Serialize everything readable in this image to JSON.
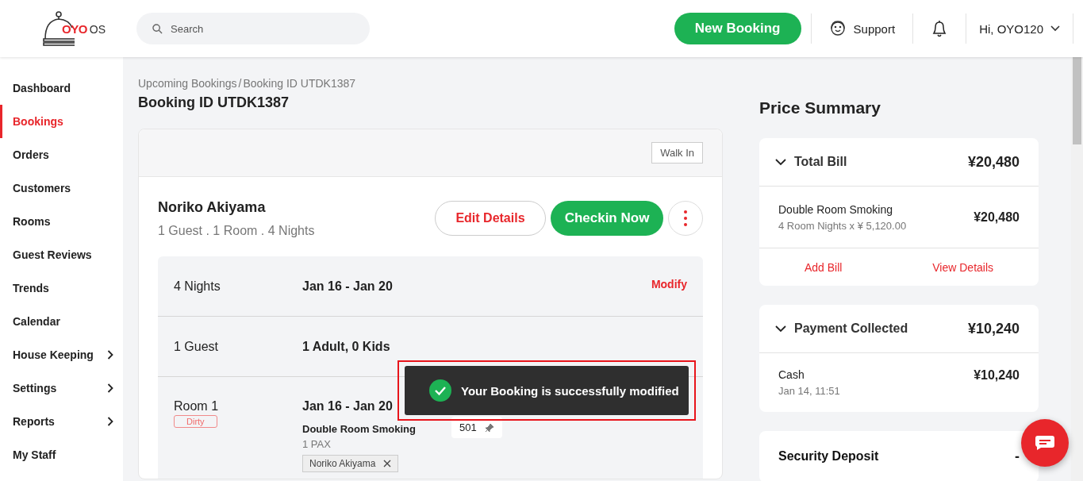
{
  "header": {
    "logo_brand": "OYO",
    "logo_suffix": "OS",
    "search": {
      "placeholder": "Search"
    },
    "new_booking": "New Booking",
    "support": "Support",
    "user": "Hi, OYO120"
  },
  "sidebar": {
    "items": [
      {
        "label": "Dashboard",
        "selected": false,
        "has_submenu": false
      },
      {
        "label": "Bookings",
        "selected": true,
        "has_submenu": false
      },
      {
        "label": "Orders",
        "selected": false,
        "has_submenu": false
      },
      {
        "label": "Customers",
        "selected": false,
        "has_submenu": false
      },
      {
        "label": "Rooms",
        "selected": false,
        "has_submenu": false
      },
      {
        "label": "Guest Reviews",
        "selected": false,
        "has_submenu": false
      },
      {
        "label": "Trends",
        "selected": false,
        "has_submenu": false
      },
      {
        "label": "Calendar",
        "selected": false,
        "has_submenu": false
      },
      {
        "label": "House Keeping",
        "selected": false,
        "has_submenu": true
      },
      {
        "label": "Settings",
        "selected": false,
        "has_submenu": true
      },
      {
        "label": "Reports",
        "selected": false,
        "has_submenu": true
      },
      {
        "label": "My Staff",
        "selected": false,
        "has_submenu": false
      }
    ]
  },
  "breadcrumb": {
    "separator": "/",
    "items": [
      "Upcoming Bookings",
      "Booking ID UTDK1387"
    ]
  },
  "title": "Booking ID UTDK1387",
  "booking": {
    "source": "Walk In",
    "guest_name": "Noriko Akiyama",
    "summary": "1 Guest . 1 Room . 4 Nights",
    "edit_button": "Edit Details",
    "checkin_button": "Checkin Now",
    "rows": [
      {
        "label": "4 Nights",
        "value": "Jan 16 - Jan 20",
        "action": "Modify"
      },
      {
        "label": "1 Guest",
        "value": "1 Adult, 0 Kids"
      }
    ],
    "room": {
      "label": "Room 1",
      "status": "Dirty",
      "dates": "Jan 16 - Jan 20",
      "room_type": "Double Room Smoking",
      "pax": "1 PAX",
      "room_number": "501",
      "guest_chip": "Noriko Akiyama"
    }
  },
  "toast": {
    "message": "Your Booking is successfully modified"
  },
  "price_summary": {
    "title": "Price Summary",
    "total_bill": {
      "label": "Total Bill",
      "amount": "¥20,480",
      "expanded": true,
      "item": {
        "name": "Double Room Smoking",
        "detail": "4 Room Nights x ¥ 5,120.00",
        "amount": "¥20,480"
      },
      "links": [
        "Add Bill",
        "View Details"
      ]
    },
    "payment": {
      "label": "Payment Collected",
      "amount": "¥10,240",
      "expanded": true,
      "item": {
        "name": "Cash",
        "detail": "Jan 14, 11:51",
        "amount": "¥10,240"
      }
    },
    "security_deposit": {
      "label": "Security Deposit",
      "amount": "-"
    }
  }
}
